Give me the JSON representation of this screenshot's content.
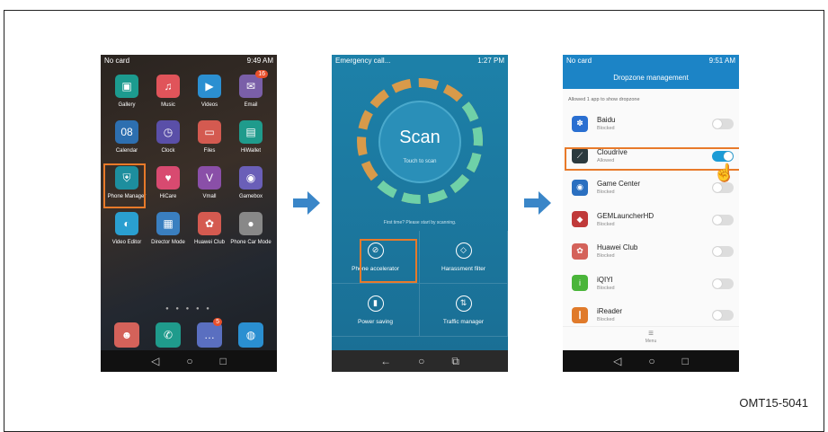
{
  "figure_ref": "OMT15-5041",
  "phone1": {
    "status_left": "No card",
    "status_right": "9:49 AM",
    "apps": [
      {
        "label": "Gallery",
        "color": "#1c9b8f",
        "glyph": "▣"
      },
      {
        "label": "Music",
        "color": "#e0545a",
        "glyph": "♫"
      },
      {
        "label": "Videos",
        "color": "#2b8fd1",
        "glyph": "▶"
      },
      {
        "label": "Email",
        "color": "#7a5fa8",
        "glyph": "✉",
        "badge": "16"
      },
      {
        "label": "Calendar",
        "color": "#2d6fb0",
        "glyph": "08"
      },
      {
        "label": "Clock",
        "color": "#5a4fa8",
        "glyph": "◷"
      },
      {
        "label": "Files",
        "color": "#d45a50",
        "glyph": "▭"
      },
      {
        "label": "HiWallet",
        "color": "#1f9b8c",
        "glyph": "▤"
      },
      {
        "label": "Phone Manager",
        "color": "#1d8e9e",
        "glyph": "⛨"
      },
      {
        "label": "HiCare",
        "color": "#d84a70",
        "glyph": "♥"
      },
      {
        "label": "Vmall",
        "color": "#8a4fa8",
        "glyph": "V"
      },
      {
        "label": "Gamebox",
        "color": "#6a5fb8",
        "glyph": "◉"
      },
      {
        "label": "Video Editor",
        "color": "#2a9fd0",
        "glyph": "◐"
      },
      {
        "label": "Director Mode",
        "color": "#3a7fc0",
        "glyph": "▦"
      },
      {
        "label": "Huawei Club",
        "color": "#d45a50",
        "glyph": "✿"
      },
      {
        "label": "Phone Car Mode",
        "color": "#888888",
        "glyph": "●"
      }
    ],
    "dock": [
      {
        "label": "Contacts",
        "color": "#d4625a",
        "glyph": "☻"
      },
      {
        "label": "Phone",
        "color": "#1f9b8c",
        "glyph": "✆"
      },
      {
        "label": "Messaging",
        "color": "#5a6fc0",
        "glyph": "…",
        "badge": "5"
      },
      {
        "label": "Browser",
        "color": "#2a8fd1",
        "glyph": "◍"
      }
    ]
  },
  "phone2": {
    "status_left": "Emergency call...",
    "status_right": "1:27 PM",
    "scan_label": "Scan",
    "scan_sub": "Touch to scan",
    "hint": "First time? Please start by scanning.",
    "tiles": [
      {
        "label": "Phone accelerator",
        "glyph": "⊘"
      },
      {
        "label": "Harassment filter",
        "glyph": "◇"
      },
      {
        "label": "Power saving",
        "glyph": "▮"
      },
      {
        "label": "Traffic manager",
        "glyph": "⇅"
      }
    ]
  },
  "phone3": {
    "status_left": "No card",
    "status_right": "9:51 AM",
    "title": "Dropzone management",
    "allowed_text": "Allowed 1 app to show dropzone",
    "apps": [
      {
        "name": "Baidu",
        "status": "Blocked",
        "on": false,
        "color": "#2a6fd1",
        "glyph": "✽"
      },
      {
        "name": "Cloudrive",
        "status": "Allowed",
        "on": true,
        "color": "#2b3a3f",
        "glyph": "⟋"
      },
      {
        "name": "Game Center",
        "status": "Blocked",
        "on": false,
        "color": "#2a6fc0",
        "glyph": "◉"
      },
      {
        "name": "GEMLauncherHD",
        "status": "Blocked",
        "on": false,
        "color": "#c03a3a",
        "glyph": "◆"
      },
      {
        "name": "Huawei Club",
        "status": "Blocked",
        "on": false,
        "color": "#d4625a",
        "glyph": "✿"
      },
      {
        "name": "iQIYI",
        "status": "Blocked",
        "on": false,
        "color": "#4ab53a",
        "glyph": "i"
      },
      {
        "name": "iReader",
        "status": "Blocked",
        "on": false,
        "color": "#e07a2a",
        "glyph": "❙"
      }
    ],
    "menu_label": "Menu"
  }
}
